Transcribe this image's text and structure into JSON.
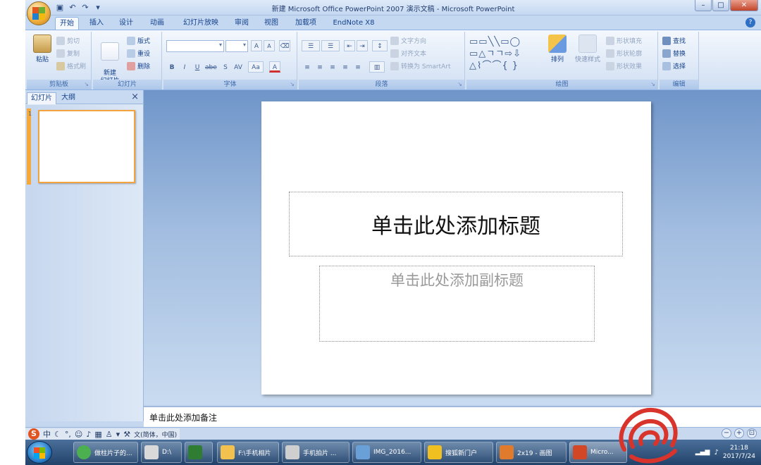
{
  "window": {
    "title": "新建 Microsoft Office PowerPoint 2007 演示文稿 - Microsoft PowerPoint",
    "controls": [
      "–",
      "□",
      "✕"
    ]
  },
  "tabs": [
    "开始",
    "插入",
    "设计",
    "动画",
    "幻灯片放映",
    "审阅",
    "视图",
    "加载项",
    "EndNote X8"
  ],
  "ribbon": {
    "clipboard": {
      "paste": "粘贴",
      "cut": "剪切",
      "copy": "复制",
      "format_painter": "格式刷",
      "label": "剪贴板"
    },
    "slides": {
      "new_slide": "新建\n幻灯片",
      "layout": "版式",
      "reset": "重设",
      "delete": "删除",
      "label": "幻灯片"
    },
    "font": {
      "grow": "A",
      "shrink": "A",
      "bold": "B",
      "italic": "I",
      "underline": "U",
      "strike": "abe",
      "shadow": "S",
      "spacing": "AV",
      "case": "Aa",
      "color": "A",
      "label": "字体"
    },
    "paragraph": {
      "text_direction": "文字方向",
      "align_text": "对齐文本",
      "smartart": "转换为 SmartArt",
      "label": "段落"
    },
    "drawing": {
      "arrange": "排列",
      "quick_styles": "快速样式",
      "shape_fill": "形状填充",
      "shape_outline": "形状轮廓",
      "shape_effects": "形状效果",
      "label": "绘图"
    },
    "editing": {
      "find": "查找",
      "replace": "替换",
      "select": "选择",
      "label": "编辑"
    }
  },
  "left_pane": {
    "tab_slides": "幻灯片",
    "tab_outline": "大纲",
    "close": "×",
    "slide_number": "1"
  },
  "slide": {
    "title_placeholder": "单击此处添加标题",
    "subtitle_placeholder": "单击此处添加副标题"
  },
  "notes": {
    "placeholder": "单击此处添加备注"
  },
  "status": {
    "language": "文(简体，中国)",
    "ime_mode": "中"
  },
  "taskbar": {
    "items": [
      {
        "label": "做柱片子的...",
        "color": "#4caf50"
      },
      {
        "label": "D:\\",
        "color": "#d9d9d9"
      },
      {
        "label": "",
        "color": "#2e7d32"
      },
      {
        "label": "F:\\手机相片",
        "color": "#f2c14e"
      },
      {
        "label": "手机拍片 ...",
        "color": "#cfcfcf"
      },
      {
        "label": "IMG_2016...",
        "color": "#6aa0d8"
      },
      {
        "label": "搜狐新门户",
        "color": "#f0c020"
      },
      {
        "label": "2x19 - 画图",
        "color": "#e07b2e"
      },
      {
        "label": "Micro...",
        "color": "#d24726"
      }
    ],
    "clock_time": "21:18",
    "clock_date": "2017/7/24"
  },
  "colors": {
    "accent": "#15428b",
    "ribbon_bg": "#dfe9f7",
    "slide_selected": "#f3a43e",
    "watermark": "#d9342b"
  }
}
